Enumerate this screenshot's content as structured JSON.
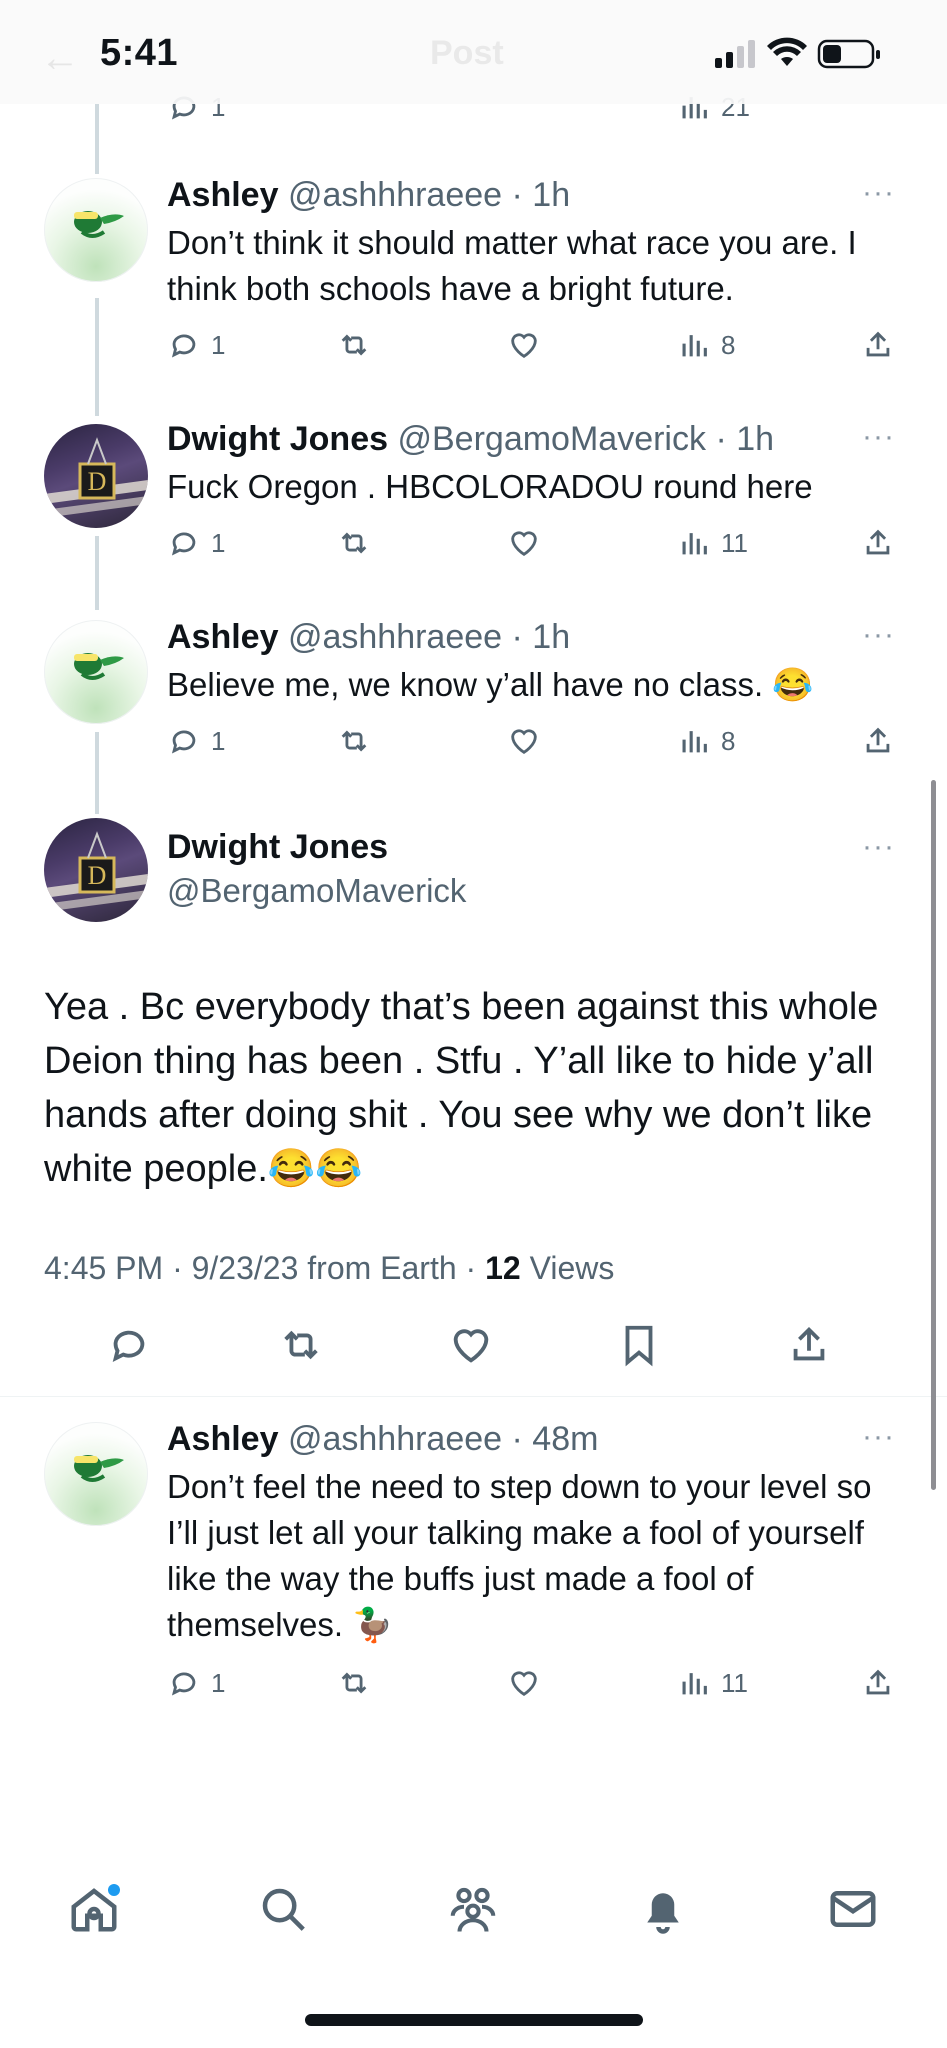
{
  "status_bar": {
    "time": "5:41",
    "header_title": "Post",
    "back_icon": "back-arrow-icon"
  },
  "replies_above": [
    {
      "name": "Ashley",
      "handle": "@ashhhraeee",
      "time": "· 1h",
      "text": "Don’t think it should matter what race you are. I think both schools have a bright future.",
      "replies": "1",
      "views": "8"
    },
    {
      "name": "Dwight Jones",
      "handle": "@BergamoMaverick",
      "time": "· 1h",
      "text": "Fuck Oregon . HBCOLORADOU round here",
      "replies": "1",
      "views": "11"
    },
    {
      "name": "Ashley",
      "handle": "@ashhhraeee",
      "time": "· 1h",
      "text": "Believe me, we know y’all have no class. 😂",
      "replies": "1",
      "views": "8"
    }
  ],
  "top_partial": {
    "views": "21",
    "replies": "1"
  },
  "main_tweet": {
    "name": "Dwight Jones",
    "handle": "@BergamoMaverick",
    "text": "Yea . Bc everybody that’s been against this whole Deion thing has been . Stfu . Y’all like to hide y’all hands after doing shit . You see why we don’t like white people.😂😂",
    "meta_prefix": "4:45 PM · 9/23/23 from Earth · ",
    "views_count": "12",
    "views_label": " Views"
  },
  "reply_below": {
    "name": "Ashley",
    "handle": "@ashhhraeee",
    "time": "· 48m",
    "text": "Don’t feel the need to step down to your level so I’ll just let all your talking make a fool of yourself like the way the buffs just made a fool of themselves. 🦆",
    "replies": "1",
    "views": "11"
  },
  "more_label": "···",
  "tab_bar": [
    "home-icon",
    "search-icon",
    "communities-icon",
    "notifications-icon",
    "messages-icon"
  ],
  "colors": {
    "text": "#0f1419",
    "secondary": "#536471",
    "accent": "#1d9bf0",
    "thread_line": "#cfd9de"
  }
}
